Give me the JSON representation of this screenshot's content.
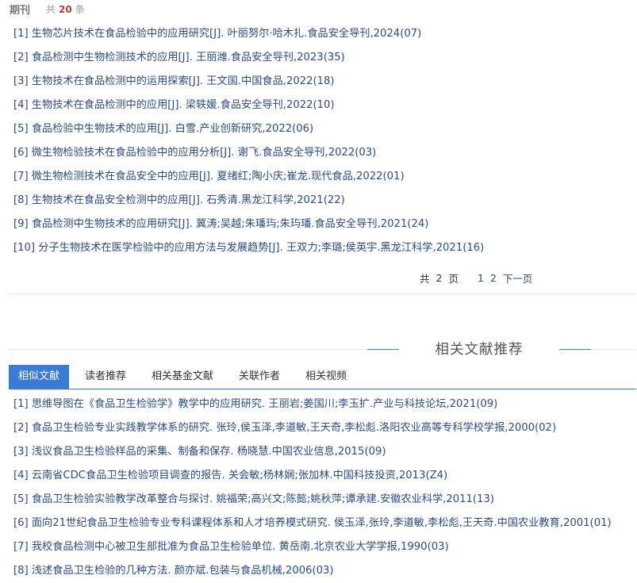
{
  "header": {
    "title": "期刊",
    "count_prefix": "共",
    "count": "20",
    "count_suffix": "条"
  },
  "journal_list": [
    "[1] 生物芯片技术在食品检验中的应用研究[J]. 叶丽努尔·哈木扎.食品安全导刊,2024(07)",
    "[2] 食品检测中生物检测技术的应用[J]. 王丽潍.食品安全导刊,2023(35)",
    "[3] 生物技术在食品检测中的运用探索[J]. 王文国.中国食品,2022(18)",
    "[4] 生物技术在食品检测中的应用[J]. 梁轶媛.食品安全导刊,2022(10)",
    "[5] 食品检验中生物技术的应用[J]. 白雪.产业创新研究,2022(06)",
    "[6] 微生物检验技术在食品检验中的应用分析[J]. 谢飞.食品安全导刊,2022(03)",
    "[7] 微生物检测技术在食品安全中的应用[J]. 夏绪红;陶小庆;崔龙.现代食品,2022(01)",
    "[8] 生物技术在食品安全检测中的应用[J]. 石秀清.黑龙江科学,2021(22)",
    "[9] 食品检测中生物技术的应用研究[J]. 冀涛;吴越;朱璠玙;朱玙璠.食品安全导刊,2021(24)",
    "[10] 分子生物技术在医学检验中的应用方法与发展趋势[J]. 王双力;李璐;侯英宇.黑龙江科学,2021(16)"
  ],
  "pager": {
    "total_prefix": "共",
    "total_pages": "2",
    "total_suffix": "页",
    "page1": "1",
    "page2": "2",
    "next": "下一页"
  },
  "related": {
    "title": "相关文献推荐",
    "tabs": [
      "相似文献",
      "读者推荐",
      "相关基金文献",
      "关联作者",
      "相关视频"
    ],
    "items": [
      "[1] 思维导图在《食品卫生检验学》教学中的应用研究. 王丽岩;姜国川;李玉扩.产业与科技论坛,2021(09)",
      "[2] 食品卫生检验专业实践教学体系的研究. 张玲,侯玉泽,李道敏,王天奇,李松彪.洛阳农业高等专科学校学报,2000(02)",
      "[3] 浅议食品卫生检验样品的采集、制备和保存. 杨晓慧.中国农业信息,2015(09)",
      "[4] 云南省CDC食品卫生检验项目调查的报告. 关会敏;杨林娴;张加林.中国科技投资,2013(Z4)",
      "[5] 食品卫生检验实验教学改革整合与探讨. 姚福荣;高兴文;陈懿;姚秋萍;谭承建.安徽农业科学,2011(13)",
      "[6] 面向21世纪食品卫生检验专业专科课程体系和人才培养模式研究. 侯玉泽,张玲,李道敏,李松彪,王天奇.中国农业教育,2001(01)",
      "[7] 我校食品检测中心被卫生部批准为食品卫生检验单位. 黄岳南.北京农业大学学报,1990(03)",
      "[8] 浅述食品卫生检验的几种方法. 颜亦斌.包装与食品机械,2006(03)"
    ]
  },
  "colors": {
    "accent": "#3a7bd5",
    "link": "#2c4c83",
    "count": "#c0392b"
  }
}
